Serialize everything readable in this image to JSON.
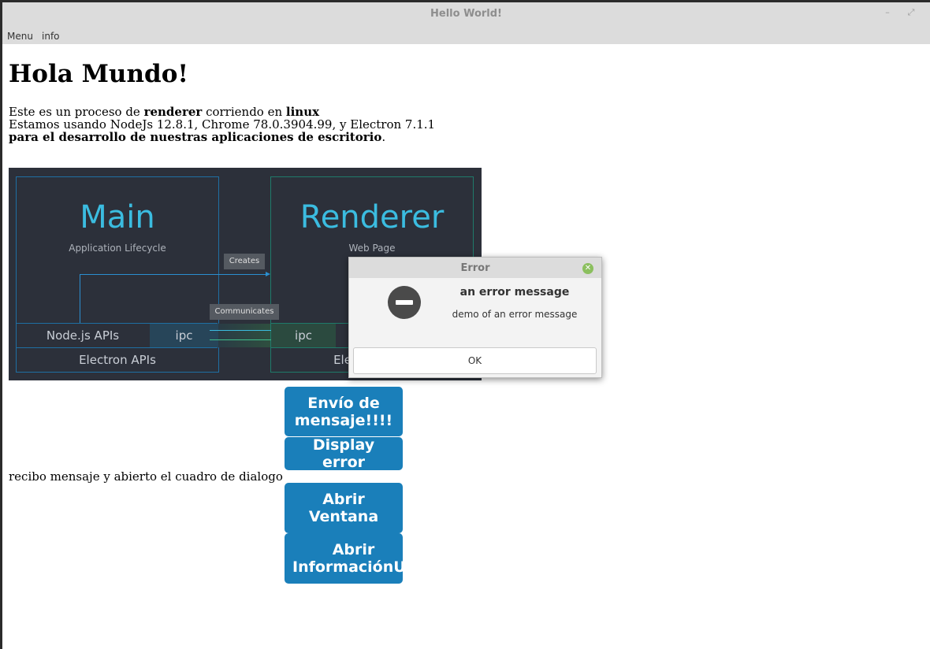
{
  "window": {
    "title": "Hello World!",
    "minimize_glyph": "–",
    "maximize_glyph": "⤢"
  },
  "menu": {
    "items": [
      "Menu",
      "info"
    ]
  },
  "page": {
    "heading": "Hola Mundo!",
    "line1_a": "Este es un proceso de ",
    "line1_b": "renderer",
    "line1_c": " corriendo en ",
    "line1_d": "linux",
    "line2": "Estamos usando NodeJs 12.8.1, Chrome 78.0.3904.99, y Electron 7.1.1",
    "line3_a": "para el desarrollo de nuestras aplicaciones de escritorio",
    "line3_b": ".",
    "recibo": "recibo mensaje y abierto el cuadro de dialogo"
  },
  "diagram": {
    "main_title": "Main",
    "main_sub": "Application Lifecycle",
    "renderer_title": "Renderer",
    "renderer_sub": "Web Page",
    "creates": "Creates",
    "communicates": "Communicates",
    "node_apis": "Node.js APIs",
    "ipc_left": "ipc",
    "ipc_right": "ipc",
    "electron_apis_left": "Electron APIs",
    "electron_apis_right": "Electron APIs"
  },
  "buttons": {
    "envio": "Envío de mensaje!!!!",
    "display_error": "Display error",
    "abrir_ventana": "Abrir Ventana",
    "abrir_info": "Abrir InformaciónUs"
  },
  "dialog": {
    "title": "Error",
    "message": "an error message",
    "detail": "demo of an error message",
    "ok_label": "OK"
  },
  "colors": {
    "button_bg": "#1a7fba",
    "diagram_bg": "#2c303a",
    "accent_cyan": "#3bbce0"
  }
}
